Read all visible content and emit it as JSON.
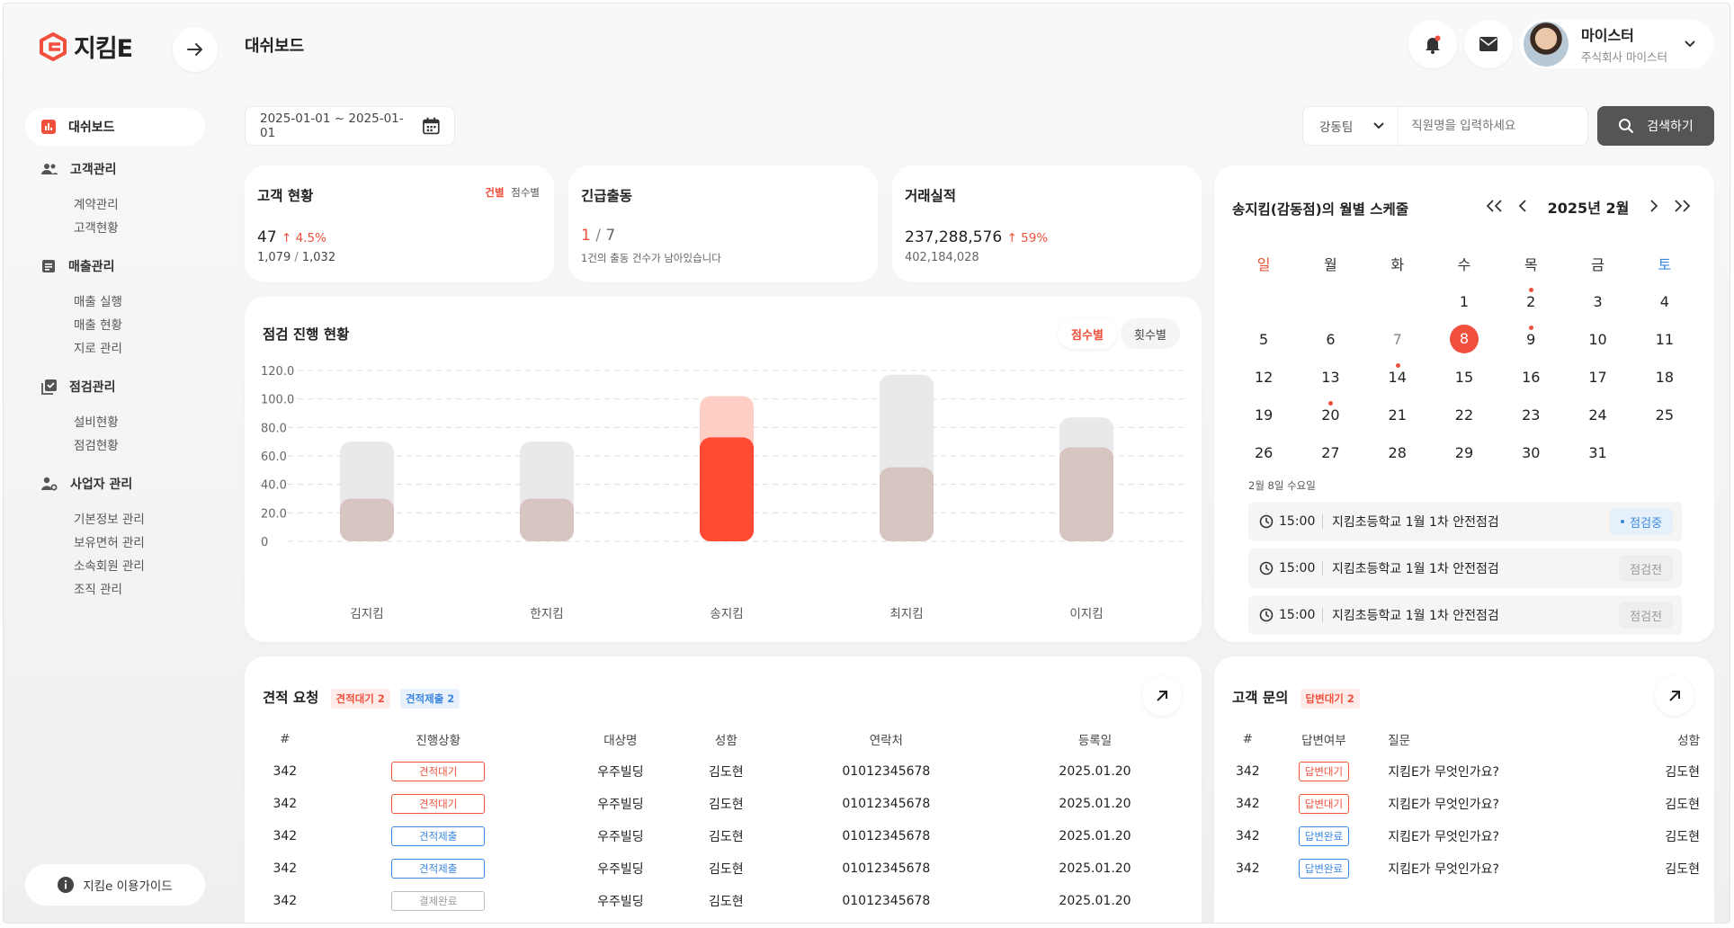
{
  "header": {
    "logo": "지킴E",
    "page_title": "대쉬보드",
    "profile_name": "마이스터",
    "profile_company": "주식회사 마이스터"
  },
  "sidebar": {
    "active": "대쉬보드",
    "groups": [
      {
        "label": "고객관리",
        "icon": "people-icon",
        "items": [
          "계약관리",
          "고객현황"
        ]
      },
      {
        "label": "매출관리",
        "icon": "document-icon",
        "items": [
          "매출 실행",
          "매출 현황",
          "지로 관리"
        ]
      },
      {
        "label": "점검관리",
        "icon": "checklist-icon",
        "items": [
          "설비현황",
          "점검현황"
        ]
      },
      {
        "label": "사업자 관리",
        "icon": "person-gear-icon",
        "items": [
          "기본정보 관리",
          "보유면허 관리",
          "소속회원 관리",
          "조직 관리"
        ]
      }
    ],
    "guide": "지킴e 이용가이드"
  },
  "filters": {
    "date_range": "2025-01-01 ~ 2025-01-01",
    "team": "강동팀",
    "search_placeholder": "직원명을 입력하세요",
    "search_button": "검색하기"
  },
  "kpi": {
    "customers": {
      "title": "고객 현황",
      "toggle_a": "건별",
      "toggle_b": "점수별",
      "value": "47",
      "change": "4.5%",
      "sub_a": "1,079",
      "sub_b": "1,032"
    },
    "emergency": {
      "title": "긴급출동",
      "value_a": "1",
      "value_b": "7",
      "note": "1건의 출동 건수가 남아있습니다"
    },
    "deals": {
      "title": "거래실적",
      "value": "237,288,576",
      "change": "59%",
      "sub": "402,184,028"
    }
  },
  "chart_section": {
    "title": "점검 진행 현황",
    "toggle_a": "점수별",
    "toggle_b": "횟수별"
  },
  "chart_data": {
    "type": "bar",
    "categories": [
      "김지킴",
      "한지킴",
      "송지킴",
      "최지킴",
      "이지킴"
    ],
    "series": [
      {
        "values": [
          30,
          30,
          73,
          52,
          66
        ]
      },
      {
        "values": [
          70,
          70,
          102,
          117,
          87
        ]
      }
    ],
    "highlight_index": 2,
    "ylim": [
      0,
      120
    ],
    "yticks": [
      "0",
      "20.0",
      "40.0",
      "60.0",
      "80.0",
      "100.0",
      "120.0"
    ]
  },
  "calendar": {
    "title": "송지킴(감동점)의 월별 스케줄",
    "month": "2025년 2월",
    "weekdays": [
      "일",
      "월",
      "화",
      "수",
      "목",
      "금",
      "토"
    ],
    "weeks": [
      [
        "",
        "",
        "",
        "1",
        "2",
        "3",
        "4"
      ],
      [
        "5",
        "6",
        "7",
        "8",
        "9",
        "10",
        "11"
      ],
      [
        "12",
        "13",
        "14",
        "15",
        "16",
        "17",
        "18"
      ],
      [
        "19",
        "20",
        "21",
        "22",
        "23",
        "24",
        "25"
      ],
      [
        "26",
        "27",
        "28",
        "29",
        "30",
        "31",
        ""
      ]
    ],
    "selected_day": "8",
    "dot_days": [
      "2",
      "9",
      "14",
      "20"
    ],
    "selected_label": "2월 8일 수요일",
    "schedule": [
      {
        "time": "15:00",
        "title": "지킴초등학교 1월 1차 안전점검",
        "status": "점검중"
      },
      {
        "time": "15:00",
        "title": "지킴초등학교 1월 1차 안전점검",
        "status": "점검전"
      },
      {
        "time": "15:00",
        "title": "지킴초등학교 1월 1차 안전점검",
        "status": "점검전"
      }
    ]
  },
  "quotes": {
    "title": "견적 요청",
    "tag_a": "견적대기 2",
    "tag_b": "견적제출 2",
    "columns": [
      "#",
      "진행상황",
      "대상명",
      "성함",
      "연락처",
      "등록일"
    ],
    "rows": [
      {
        "no": "342",
        "status": "견적대기",
        "target": "우주빌딩",
        "name": "김도현",
        "phone": "01012345678",
        "date": "2025.01.20"
      },
      {
        "no": "342",
        "status": "견적대기",
        "target": "우주빌딩",
        "name": "김도현",
        "phone": "01012345678",
        "date": "2025.01.20"
      },
      {
        "no": "342",
        "status": "견적제출",
        "target": "우주빌딩",
        "name": "김도현",
        "phone": "01012345678",
        "date": "2025.01.20"
      },
      {
        "no": "342",
        "status": "견적제출",
        "target": "우주빌딩",
        "name": "김도현",
        "phone": "01012345678",
        "date": "2025.01.20"
      },
      {
        "no": "342",
        "status": "결제완료",
        "target": "우주빌딩",
        "name": "김도현",
        "phone": "01012345678",
        "date": "2025.01.20"
      }
    ]
  },
  "inquiries": {
    "title": "고객 문의",
    "tag": "답변대기 2",
    "columns": [
      "#",
      "답변여부",
      "질문",
      "성함"
    ],
    "rows": [
      {
        "no": "342",
        "status": "답변대기",
        "question": "지킴E가 무엇인가요?",
        "name": "김도현"
      },
      {
        "no": "342",
        "status": "답변대기",
        "question": "지킴E가 무엇인가요?",
        "name": "김도현"
      },
      {
        "no": "342",
        "status": "답변완료",
        "question": "지킴E가 무엇인가요?",
        "name": "김도현"
      },
      {
        "no": "342",
        "status": "답변완료",
        "question": "지킴E가 무엇인가요?",
        "name": "김도현"
      }
    ]
  },
  "colors": {
    "accent": "#f0503c",
    "bar_bg": "#e9e9ec",
    "bar_fg": "#d6c5c1",
    "bar_hl_bg": "#ffcfc6",
    "bar_hl_fg": "#ff4b33"
  }
}
